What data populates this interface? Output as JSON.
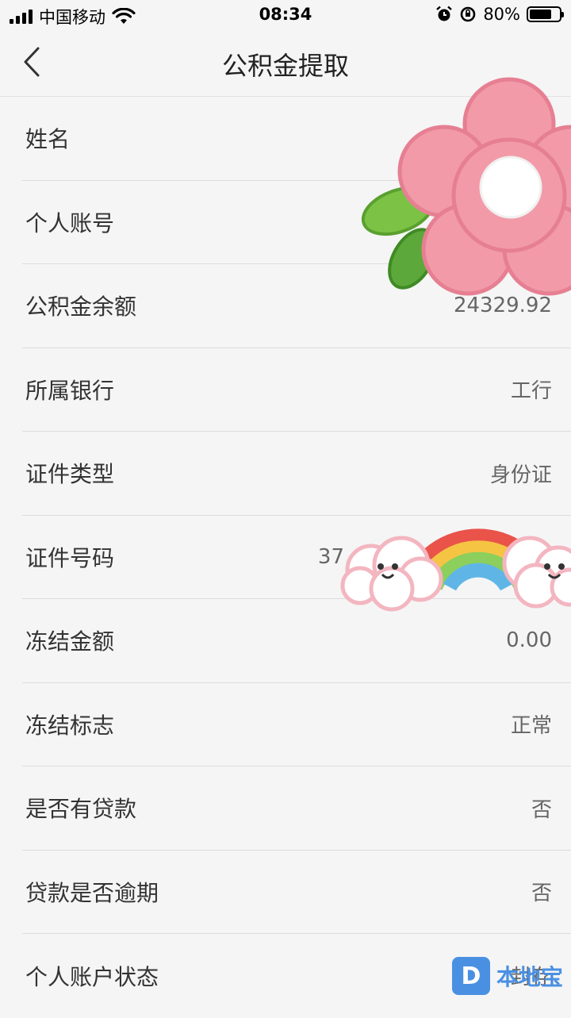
{
  "status_bar": {
    "carrier": "中国移动",
    "time": "08:34",
    "battery": "80%",
    "battery_level": 0.8
  },
  "nav": {
    "title": "公积金提取",
    "back_icon": "chevron-left-icon"
  },
  "rows": [
    {
      "label": "姓名",
      "value": ""
    },
    {
      "label": "个人账号",
      "value": ""
    },
    {
      "label": "公积金余额",
      "value": "24329.92"
    },
    {
      "label": "所属银行",
      "value": "工行"
    },
    {
      "label": "证件类型",
      "value": "身份证"
    },
    {
      "label": "证件号码",
      "value": "37"
    },
    {
      "label": "冻结金额",
      "value": "0.00"
    },
    {
      "label": "冻结标志",
      "value": "正常"
    },
    {
      "label": "是否有贷款",
      "value": "否"
    },
    {
      "label": "贷款是否逾期",
      "value": "否"
    },
    {
      "label": "个人账户状态",
      "value": "封存"
    }
  ],
  "watermark": {
    "logo_letter": "D",
    "text": "本地宝"
  }
}
